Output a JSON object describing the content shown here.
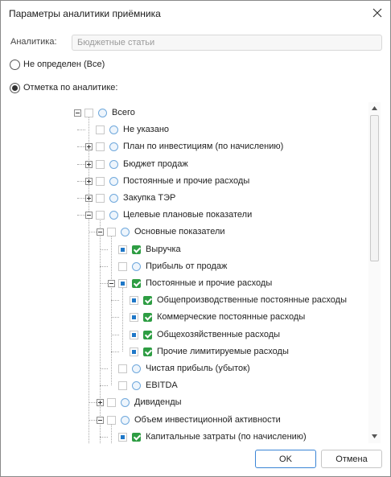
{
  "dialog": {
    "title": "Параметры аналитики приёмника",
    "close_icon": "close-icon"
  },
  "analytics_field": {
    "label": "Аналитика:",
    "value": "Бюджетные статьи"
  },
  "radio_options": [
    {
      "label": "Не определен (Все)",
      "checked": false
    },
    {
      "label": "Отметка по аналитике:",
      "checked": true
    }
  ],
  "tree": [
    {
      "label": "Всего",
      "level": 0,
      "expander": "minus",
      "cb": "empty",
      "sel": "circle"
    },
    {
      "label": "Не указано",
      "level": 1,
      "expander": "none",
      "cb": "empty",
      "sel": "circle"
    },
    {
      "label": "План по инвестициям (по начислению)",
      "level": 1,
      "expander": "plus",
      "cb": "empty",
      "sel": "circle"
    },
    {
      "label": "Бюджет продаж",
      "level": 1,
      "expander": "plus",
      "cb": "empty",
      "sel": "circle"
    },
    {
      "label": "Постоянные и прочие расходы",
      "level": 1,
      "expander": "plus",
      "cb": "empty",
      "sel": "circle"
    },
    {
      "label": "Закупка ТЭР",
      "level": 1,
      "expander": "plus",
      "cb": "empty",
      "sel": "circle"
    },
    {
      "label": "Целевые плановые показатели",
      "level": 1,
      "expander": "minus",
      "cb": "empty",
      "sel": "circle"
    },
    {
      "label": "Основные показатели",
      "level": 2,
      "expander": "minus",
      "cb": "empty",
      "sel": "circle"
    },
    {
      "label": "Выручка",
      "level": 3,
      "expander": "none",
      "cb": "partial",
      "sel": "check"
    },
    {
      "label": "Прибыль от продаж",
      "level": 3,
      "expander": "none",
      "cb": "empty",
      "sel": "circle"
    },
    {
      "label": "Постоянные и прочие расходы",
      "level": 3,
      "expander": "minus",
      "cb": "partial",
      "sel": "check"
    },
    {
      "label": "Общепроизводственные постоянные расходы",
      "level": 4,
      "expander": "none",
      "cb": "partial",
      "sel": "check"
    },
    {
      "label": "Коммерческие постоянные расходы",
      "level": 4,
      "expander": "none",
      "cb": "partial",
      "sel": "check"
    },
    {
      "label": "Общехозяйственные расходы",
      "level": 4,
      "expander": "none",
      "cb": "partial",
      "sel": "check"
    },
    {
      "label": "Прочие лимитируемые расходы",
      "level": 4,
      "expander": "none",
      "cb": "partial",
      "sel": "check"
    },
    {
      "label": "Чистая прибыль (убыток)",
      "level": 3,
      "expander": "none",
      "cb": "empty",
      "sel": "circle"
    },
    {
      "label": "EBITDA",
      "level": 3,
      "expander": "none",
      "cb": "empty",
      "sel": "circle"
    },
    {
      "label": "Дивиденды",
      "level": 2,
      "expander": "plus",
      "cb": "empty",
      "sel": "circle"
    },
    {
      "label": "Объем инвестиционной активности",
      "level": 2,
      "expander": "minus",
      "cb": "empty",
      "sel": "circle"
    },
    {
      "label": "Капитальные затраты (по начислению)",
      "level": 3,
      "expander": "none",
      "cb": "partial",
      "sel": "check"
    }
  ],
  "buttons": {
    "ok": "OK",
    "cancel": "Отмена"
  },
  "colors": {
    "checked_green": "#2e9d43",
    "partial_blue": "#1f78c8",
    "ok_border": "#3a85d6"
  }
}
